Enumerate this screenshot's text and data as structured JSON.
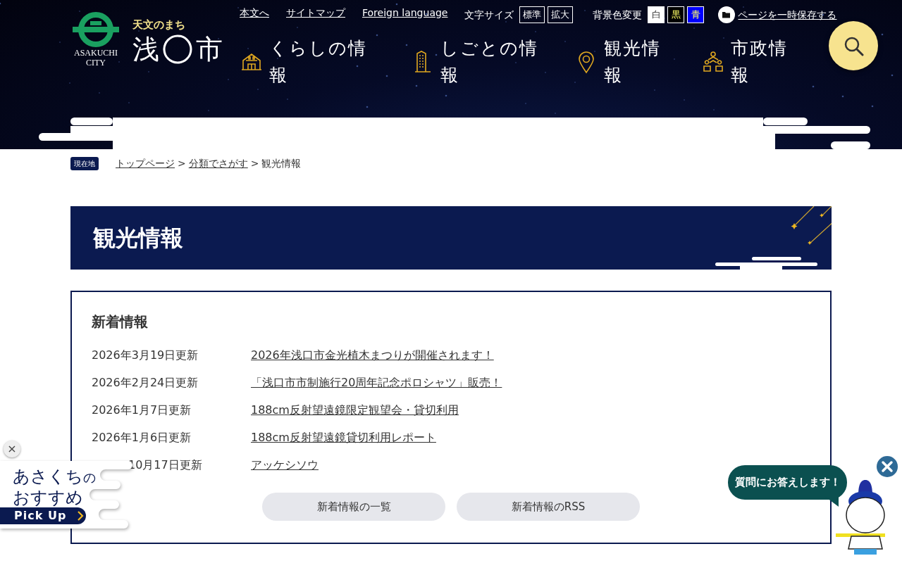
{
  "header": {
    "logo_lines": [
      "ASAKUCHI",
      "CITY"
    ],
    "tagline": "天文のまち",
    "city_name": [
      "浅",
      "市"
    ],
    "utility_links": [
      "本文へ",
      "サイトマップ",
      "Foreign language"
    ],
    "font_size": {
      "label": "文字サイズ",
      "options": [
        "標準",
        "拡大"
      ]
    },
    "bg_color": {
      "label": "背景色変更",
      "options": [
        {
          "label": "白",
          "color": "#ffffff"
        },
        {
          "label": "黒",
          "color": "#000000"
        },
        {
          "label": "青",
          "color": "#0000ff"
        }
      ]
    },
    "save_link": "ページを一時保存する",
    "nav": [
      {
        "label": "くらしの情報",
        "kind": "house"
      },
      {
        "label": "しごとの情報",
        "kind": "building"
      },
      {
        "label": "観光情報",
        "kind": "pin"
      },
      {
        "label": "市政情報",
        "kind": "people"
      }
    ]
  },
  "breadcrumb": {
    "badge": "現在地",
    "items": [
      {
        "label": "トップページ",
        "kind": "link"
      },
      {
        "label": ">",
        "kind": "sep"
      },
      {
        "label": "分類でさがす",
        "kind": "link"
      },
      {
        "label": ">",
        "kind": "sep"
      },
      {
        "label": "観光情報",
        "kind": "current"
      }
    ]
  },
  "page_title": "観光情報",
  "news": {
    "heading": "新着情報",
    "items": [
      {
        "date": "2026年3月19日更新",
        "title": "2026年浅口市金光植木まつりが開催されます！"
      },
      {
        "date": "2026年2月24日更新",
        "title": "「浅口市市制施行20周年記念ポロシャツ」販売！"
      },
      {
        "date": "2026年1月7日更新",
        "title": "188cm反射望遠鏡限定観望会・貸切利用"
      },
      {
        "date": "2026年1月6日更新",
        "title": "188cm反射望遠鏡貸切利用レポート"
      },
      {
        "date": "10月17日更新",
        "title": "アッケシソウ",
        "partial": true
      }
    ],
    "buttons": [
      "新着情報の一覧",
      "新着情報のRSS"
    ]
  },
  "pickup": {
    "close": "×",
    "title": "あさくち",
    "title_suffix": "の",
    "line2": "おすすめ",
    "button": "Pick Up"
  },
  "chat": {
    "bubble": "質問にお答えします！"
  }
}
